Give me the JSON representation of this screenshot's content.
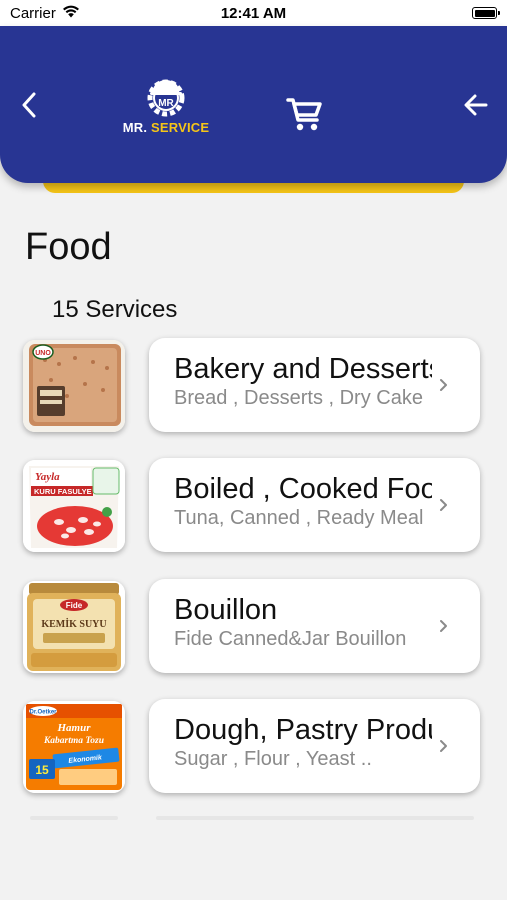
{
  "status_bar": {
    "carrier": "Carrier",
    "time": "12:41 AM"
  },
  "header": {
    "logo_badge": "MR",
    "logo_text_mr": "MR.",
    "logo_text_service": "SERVICE",
    "colors": {
      "bar": "#283593",
      "accent": "#f5c518"
    }
  },
  "page": {
    "title": "Food",
    "services_count": "15 Services"
  },
  "services": [
    {
      "title": "Bakery and Desserts",
      "subtitle": "Bread , Desserts , Dry Cake",
      "image": "bakery-product-image"
    },
    {
      "title": "Boiled , Cooked Food",
      "subtitle": "Tuna, Canned , Ready Meal",
      "image": "kuru-fasulye-can-image"
    },
    {
      "title": "Bouillon",
      "subtitle": "Fide Canned&Jar Bouillon",
      "image": "kemik-suyu-jar-image"
    },
    {
      "title": "Dough, Pastry Products",
      "subtitle": "Sugar , Flour , Yeast ..",
      "image": "baking-powder-pack-image"
    }
  ],
  "icons": {
    "back_left": "chevron-left-icon",
    "back_right": "arrow-left-icon",
    "cart": "shopping-cart-icon",
    "row_chevron": "chevron-right-icon",
    "wifi": "wifi-icon",
    "battery": "battery-icon"
  }
}
